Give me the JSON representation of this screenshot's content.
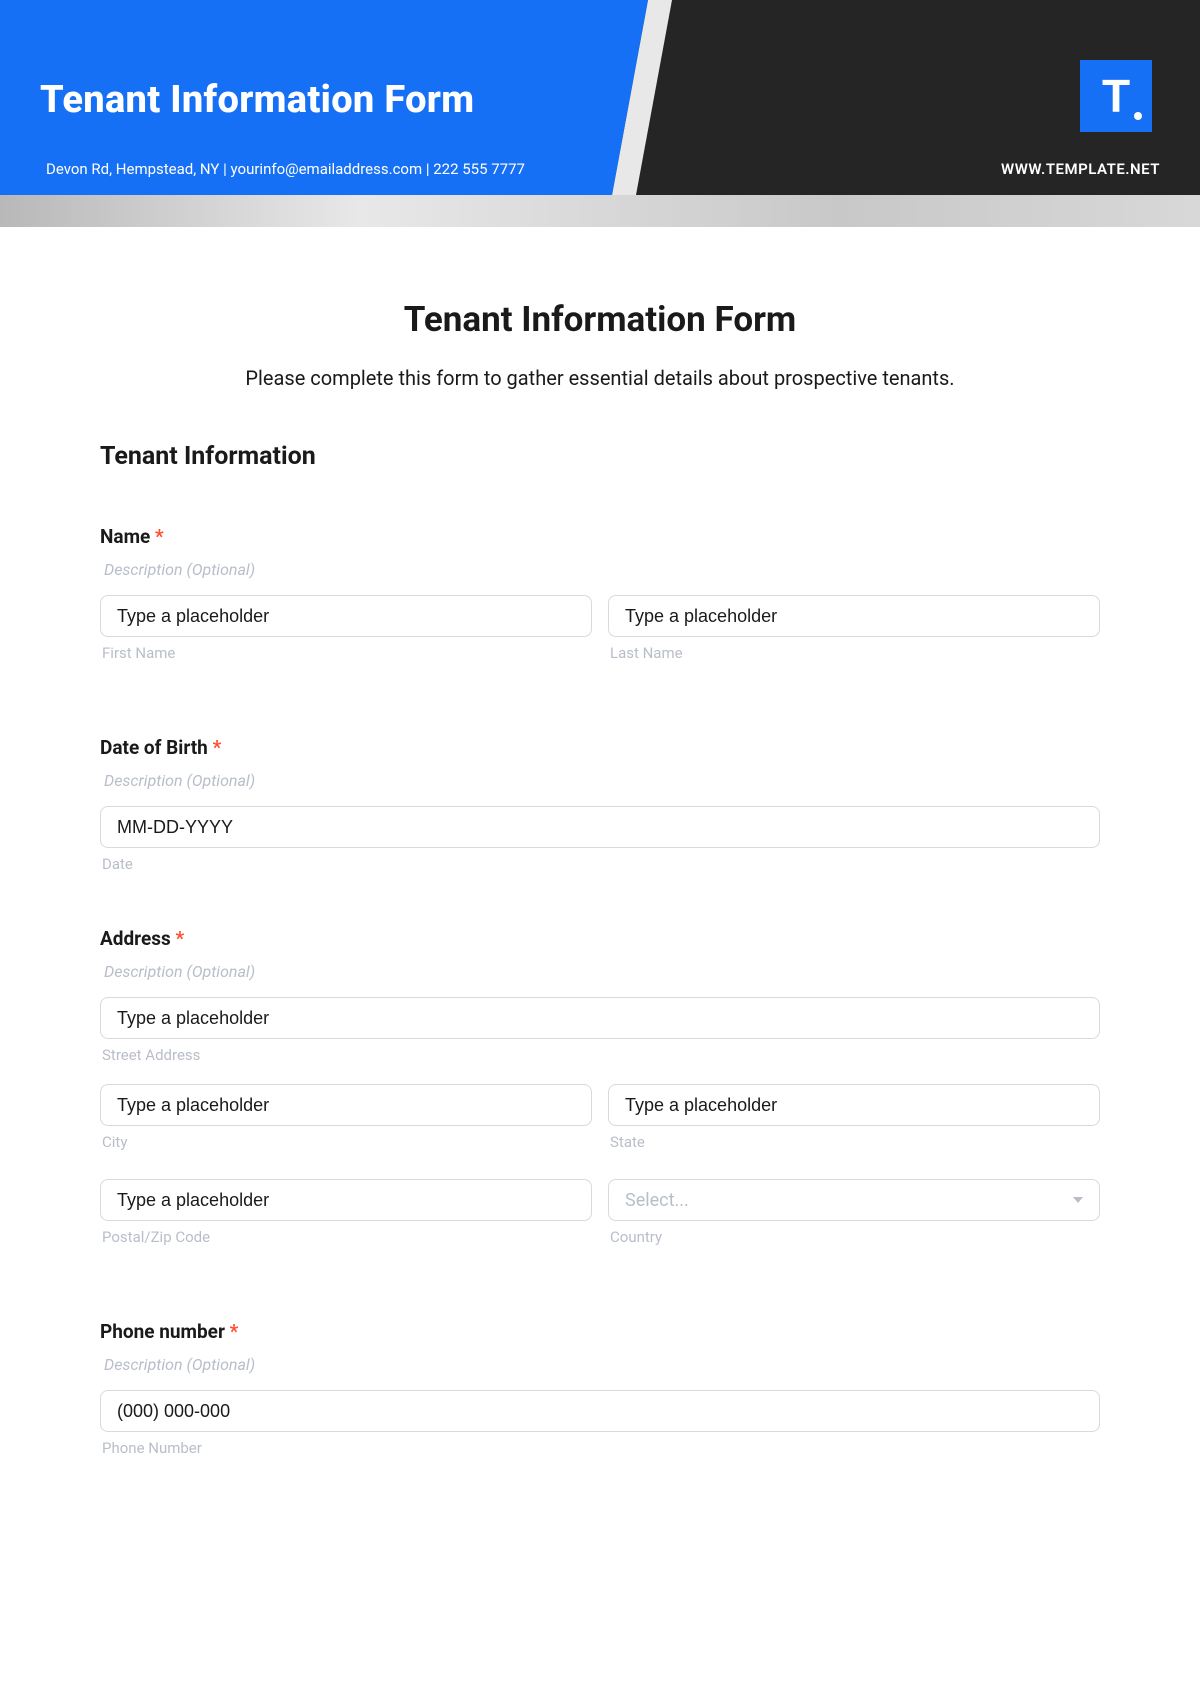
{
  "banner": {
    "title": "Tenant Information Form",
    "subtitle": "Devon Rd, Hempstead, NY | yourinfo@emailaddress.com | 222 555 7777",
    "logo_letter": "T",
    "url": "WWW.TEMPLATE.NET"
  },
  "page": {
    "title": "Tenant Information Form",
    "description": "Please complete this form to gather essential details about prospective tenants."
  },
  "section": {
    "title": "Tenant Information"
  },
  "fields": {
    "name": {
      "label": "Name",
      "desc": "Description (Optional)",
      "first_placeholder": "Type a placeholder",
      "first_sub": "First Name",
      "last_placeholder": "Type a placeholder",
      "last_sub": "Last Name"
    },
    "dob": {
      "label": "Date of Birth",
      "desc": "Description (Optional)",
      "placeholder": "MM-DD-YYYY",
      "sub": "Date"
    },
    "address": {
      "label": "Address",
      "desc": "Description (Optional)",
      "street_placeholder": "Type a placeholder",
      "street_sub": "Street Address",
      "city_placeholder": "Type a placeholder",
      "city_sub": "City",
      "state_placeholder": "Type a placeholder",
      "state_sub": "State",
      "postal_placeholder": "Type a placeholder",
      "postal_sub": "Postal/Zip Code",
      "country_placeholder": "Select...",
      "country_sub": "Country"
    },
    "phone": {
      "label": "Phone number",
      "desc": "Description (Optional)",
      "placeholder": "(000) 000-000",
      "sub": "Phone Number"
    }
  },
  "common": {
    "required_mark": "*"
  }
}
